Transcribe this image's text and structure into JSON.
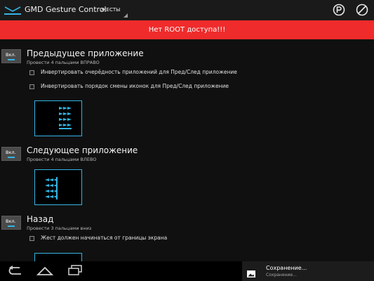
{
  "app": {
    "title": "GMD Gesture Control"
  },
  "spinner": {
    "label": "ЖЕСТЫ"
  },
  "banner": {
    "text": "Нет ROOT доступа!!!"
  },
  "gestures": [
    {
      "toggle": "Вкл.",
      "title": "Предыдущее приложение",
      "subtitle": "Провести 4 пальцами ВПРАВО",
      "options": [
        "Инвертировать очерёдность приложений для Пред/След приложение",
        "Инвертировать порядок смены иконок для Пред/След приложение"
      ]
    },
    {
      "toggle": "Вкл.",
      "title": "Следующее приложение",
      "subtitle": "Провести 4 пальцами ВЛЕВО",
      "options": []
    },
    {
      "toggle": "Вкл.",
      "title": "Назад",
      "subtitle": "Провести 3 пальцами вниз",
      "options": [
        "Жест должен начинаться от границы экрана"
      ]
    }
  ],
  "notification": {
    "title": "Сохранение...",
    "subtitle": "Сохранение..."
  },
  "colors": {
    "accent": "#33b5e5",
    "banner": "#ef2b2b"
  }
}
